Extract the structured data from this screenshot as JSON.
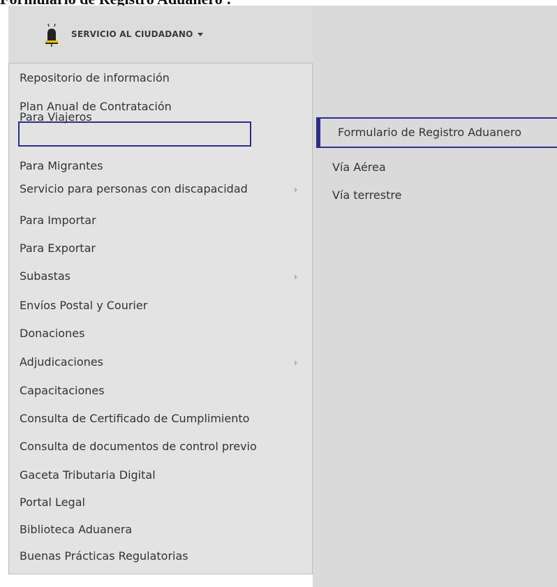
{
  "document": {
    "title": "Formulario de Registro Aduanero :"
  },
  "menu": {
    "header_label": "SERVICIO AL CIUDADANO",
    "items": [
      {
        "label": "Repositorio de información",
        "has_submenu": false
      },
      {
        "label": "Plan Anual de Contratación",
        "has_submenu": false
      },
      {
        "label": "Para Viajeros",
        "has_submenu": false,
        "highlighted": true
      },
      {
        "label": "Para Migrantes",
        "has_submenu": false
      },
      {
        "label": "Servicio para personas con discapacidad",
        "has_submenu": true
      },
      {
        "label": "Para Importar",
        "has_submenu": false
      },
      {
        "label": "Para Exportar",
        "has_submenu": false
      },
      {
        "label": "Subastas",
        "has_submenu": true
      },
      {
        "label": "Envíos Postal y Courier",
        "has_submenu": false
      },
      {
        "label": "Donaciones",
        "has_submenu": false
      },
      {
        "label": "Adjudicaciones",
        "has_submenu": true
      },
      {
        "label": "Capacitaciones",
        "has_submenu": false
      },
      {
        "label": "Consulta de Certificado de Cumplimiento",
        "has_submenu": false
      },
      {
        "label": "Consulta de documentos de control previo",
        "has_submenu": false
      },
      {
        "label": "Gaceta Tributaria Digital",
        "has_submenu": false
      },
      {
        "label": "Portal Legal",
        "has_submenu": false
      },
      {
        "label": "Biblioteca Aduanera",
        "has_submenu": false
      },
      {
        "label": "Buenas Prácticas Regulatorias",
        "has_submenu": false
      }
    ]
  },
  "submenu": {
    "items": [
      {
        "label": "Formulario de Registro Aduanero",
        "highlighted": true
      },
      {
        "label": "Vía Aérea"
      },
      {
        "label": "Vía terrestre"
      }
    ]
  },
  "icons": {
    "header": "bell-icon",
    "submenu_indicator": "chevron-right-icon"
  },
  "colors": {
    "highlight": "#2a2f8c",
    "menu_bg": "#e3e3e3",
    "header_bg": "#dcdcdc"
  }
}
